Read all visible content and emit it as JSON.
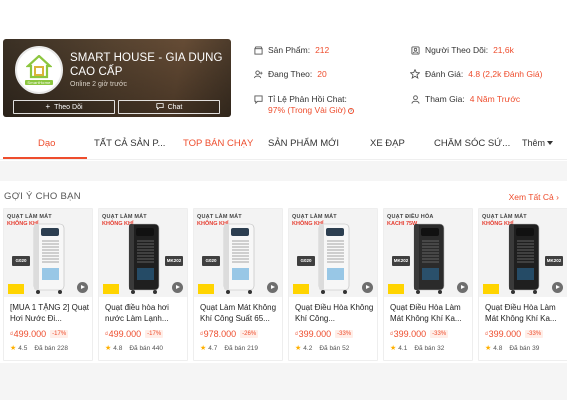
{
  "shop": {
    "name": "SMART HOUSE - GIA DỤNG CAO CẤP",
    "online": "Online 2 giờ trước",
    "follow_label": "Theo Dõi",
    "chat_label": "Chat",
    "logo_text": "SmartHome"
  },
  "stats": {
    "products_label": "Sản Phẩm:",
    "products_value": "212",
    "following_label": "Đang Theo:",
    "following_value": "20",
    "chat_label": "Tỉ Lệ Phản Hồi Chat:",
    "chat_value": "97% (Trong Vài Giờ)",
    "followers_label": "Người Theo Dõi:",
    "followers_value": "21,6k",
    "rating_label": "Đánh Giá:",
    "rating_value": "4.8 (2,2k Đánh Giá)",
    "joined_label": "Tham Gia:",
    "joined_value": "4 Năm Trước"
  },
  "tabs": [
    "Dạo",
    "TẤT CẢ SẢN P...",
    "TOP BÁN CHẠY",
    "SẢN PHẨM MỚI",
    "XE ĐẠP",
    "CHĂM SÓC SỨ...",
    "Thêm"
  ],
  "section": {
    "title": "GỢI Ý CHO BẠN",
    "see_all": "Xem Tất Cả"
  },
  "products": [
    {
      "head1": "QUẠT LÀM MÁT",
      "head2": "KHÔNG KHÍ",
      "model": "G020",
      "title": "[MUA 1 TẶNG 2] Quạt Hơi Nước Đi...",
      "currency": "₫",
      "price": "499.000",
      "discount": "-17%",
      "rating": "4.5",
      "sold": "Đã bán 228",
      "style": "white"
    },
    {
      "head1": "QUẠT LÀM MÁT",
      "head2": "KHÔNG KHÍ",
      "model": "MK202",
      "title": "Quạt điều hòa hơi nước Làm Lạnh...",
      "currency": "₫",
      "price": "499.000",
      "discount": "-17%",
      "rating": "4.8",
      "sold": "Đã bán 440",
      "style": "black"
    },
    {
      "head1": "QUẠT LÀM MÁT",
      "head2": "KHÔNG KHÍ",
      "model": "G020",
      "title": "Quạt Làm Mát Không Khí Công Suất 65...",
      "currency": "₫",
      "price": "978.000",
      "discount": "-26%",
      "rating": "4.7",
      "sold": "Đã bán 219",
      "style": "white"
    },
    {
      "head1": "QUẠT LÀM MÁT",
      "head2": "KHÔNG KHÍ",
      "model": "G020",
      "title": "Quạt Điều Hòa Không Khí Công...",
      "currency": "₫",
      "price": "399.000",
      "discount": "-33%",
      "rating": "4.2",
      "sold": "Đã bán 52",
      "style": "white"
    },
    {
      "head1": "QUẠT ĐIỀU HÒA",
      "head2": "KACHI 75W",
      "model": "MK202",
      "title": "Quạt Điều Hòa Làm Mát Không Khí Ka...",
      "currency": "₫",
      "price": "399.000",
      "discount": "-33%",
      "rating": "4.1",
      "sold": "Đã bán 32",
      "style": "dark"
    },
    {
      "head1": "QUẠT LÀM MÁT",
      "head2": "KHÔNG KHÍ",
      "model": "MK202",
      "title": "Quạt Điều Hòa Làm Mát Không Khí Ka...",
      "currency": "₫",
      "price": "399.000",
      "discount": "-33%",
      "rating": "4.8",
      "sold": "Đã bán 39",
      "style": "black"
    }
  ],
  "colors": {
    "accent": "#ee4d2d",
    "star": "#ffb000",
    "logo_green": "#8cc63f"
  }
}
